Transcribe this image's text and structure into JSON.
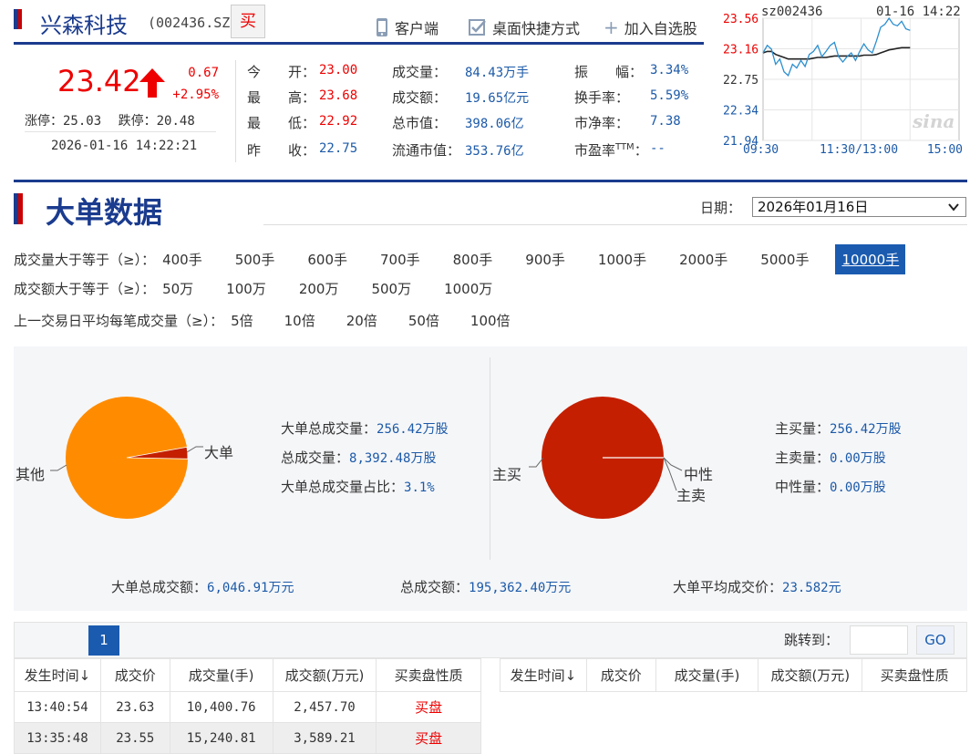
{
  "header": {
    "stock_name": "兴森科技",
    "stock_code": "(002436.SZ)",
    "buy_button": "买",
    "links": [
      "客户端",
      "桌面快捷方式",
      "加入自选股"
    ]
  },
  "quote": {
    "price": "23.42",
    "change": "0.67",
    "change_pct": "+2.95%",
    "limit_up_label": "涨停：",
    "limit_up": "25.03",
    "limit_down_label": "跌停：",
    "limit_down": "20.48",
    "datetime": "2026-01-16 14:22:21",
    "rows": [
      [
        {
          "l": "今　　开：",
          "v": "23.00",
          "c": "red"
        },
        {
          "l": "成交量：",
          "v": "84.43万手",
          "c": "blue"
        },
        {
          "l": "振　　幅：",
          "v": "3.34%",
          "c": "blue"
        }
      ],
      [
        {
          "l": "最　　高：",
          "v": "23.68",
          "c": "red"
        },
        {
          "l": "成交额：",
          "v": "19.65亿元",
          "c": "blue"
        },
        {
          "l": "换手率：",
          "v": "5.59%",
          "c": "blue"
        }
      ],
      [
        {
          "l": "最　　低：",
          "v": "22.92",
          "c": "red"
        },
        {
          "l": "总市值：",
          "v": "398.06亿",
          "c": "blue"
        },
        {
          "l": "市净率：",
          "v": "7.38",
          "c": "blue"
        }
      ],
      [
        {
          "l": "昨　　收：",
          "v": "22.75",
          "c": "blue"
        },
        {
          "l": "流通市值：",
          "v": "353.76亿",
          "c": "blue"
        },
        {
          "l": "市盈率TTM：",
          "v": "--",
          "c": "blue"
        }
      ]
    ]
  },
  "mini_chart": {
    "symbol": "sz002436",
    "datetime": "01-16 14:22",
    "y_ticks": [
      "23.56",
      "23.16",
      "22.75",
      "22.34",
      "21.94"
    ],
    "x_ticks": [
      "09:30",
      "11:30/13:00",
      "15:00"
    ],
    "watermark": "sina",
    "price_line_color": "#2b8fd0",
    "avg_line_color": "#222222"
  },
  "section": {
    "title": "大单数据",
    "date_label": "日期：",
    "date_value": "2026年01月16日"
  },
  "filters": {
    "volume_label": "成交量大于等于（≥）：",
    "volume_options": [
      "400手",
      "500手",
      "600手",
      "700手",
      "800手",
      "900手",
      "1000手",
      "2000手",
      "5000手",
      "10000手"
    ],
    "volume_active": "10000手",
    "amount_label": "成交额大于等于（≥）：",
    "amount_options": [
      "50万",
      "100万",
      "200万",
      "500万",
      "1000万"
    ],
    "multiple_label": "上一交易日平均每笔成交量（≥）：",
    "multiple_options": [
      "5倍",
      "10倍",
      "20倍",
      "50倍",
      "100倍"
    ]
  },
  "summary": {
    "pie1_labels": {
      "big": "大单",
      "other": "其他"
    },
    "big_volume_label": "大单总成交量：",
    "big_volume": "256.42万股",
    "total_volume_label": "总成交量：",
    "total_volume": "8,392.48万股",
    "big_ratio_label": "大单总成交量占比：",
    "big_ratio": "3.1%",
    "pie2_labels": {
      "buy": "主买",
      "neutral": "中性",
      "sell": "主卖"
    },
    "buy_volume_label": "主买量：",
    "buy_volume": "256.42万股",
    "sell_volume_label": "主卖量：",
    "sell_volume": "0.00万股",
    "neutral_volume_label": "中性量：",
    "neutral_volume": "0.00万股",
    "big_amount_label": "大单总成交额：",
    "big_amount": "6,046.91万元",
    "total_amount_label": "总成交额：",
    "total_amount": "195,362.40万元",
    "avg_price_label": "大单平均成交价：",
    "avg_price": "23.582元",
    "colors": {
      "orange": "#ff8c00",
      "darkred": "#c41f00"
    }
  },
  "pager": {
    "page": "1",
    "jump_label": "跳转到：",
    "go": "GO"
  },
  "table": {
    "headers": [
      "发生时间↓",
      "成交价",
      "成交量(手)",
      "成交额(万元)",
      "买卖盘性质"
    ],
    "rows": [
      [
        "13:40:54",
        "23.63",
        "10,400.76",
        "2,457.70",
        "买盘"
      ],
      [
        "13:35:48",
        "23.55",
        "15,240.81",
        "3,589.21",
        "买盘"
      ]
    ]
  },
  "chart_data": [
    {
      "type": "pie",
      "title": "",
      "labels": [
        "大单",
        "其他"
      ],
      "values": [
        3.1,
        96.9
      ],
      "colors": [
        "#c41f00",
        "#ff8c00"
      ]
    },
    {
      "type": "pie",
      "title": "",
      "labels": [
        "主买",
        "中性",
        "主卖"
      ],
      "values": [
        100,
        0,
        0
      ],
      "colors": [
        "#c41f00",
        "#ff8c00",
        "#999999"
      ]
    },
    {
      "type": "line",
      "title": "",
      "ylim": [
        21.94,
        23.56
      ],
      "series": [
        {
          "x": [
            "09:30",
            "09:36",
            "09:42",
            "09:48",
            "09:54",
            "10:00",
            "10:06",
            "10:12",
            "10:18",
            "10:24",
            "10:30",
            "10:36",
            "10:42",
            "10:48",
            "10:54",
            "11:00",
            "11:06",
            "11:12",
            "11:18",
            "11:24",
            "11:30",
            "13:00",
            "13:06",
            "13:12",
            "13:18",
            "13:24",
            "13:30",
            "13:36",
            "13:42",
            "13:48",
            "13:54",
            "14:00",
            "14:06",
            "14:12",
            "14:18",
            "14:22"
          ],
          "values": [
            23.1,
            23.2,
            23.15,
            22.95,
            23.02,
            22.85,
            22.8,
            22.95,
            22.9,
            23.0,
            22.92,
            23.08,
            23.12,
            23.2,
            23.05,
            23.12,
            23.2,
            23.24,
            23.05,
            22.98,
            23.05,
            23.1,
            23.0,
            23.12,
            23.22,
            23.14,
            23.1,
            23.26,
            23.44,
            23.48,
            23.56,
            23.48,
            23.46,
            23.52,
            23.42,
            23.4
          ]
        },
        {
          "values": [
            23.1,
            23.12,
            23.12,
            23.08,
            23.06,
            23.04,
            23.02,
            23.02,
            23.02,
            23.02,
            23.02,
            23.02,
            23.03,
            23.04,
            23.04,
            23.04,
            23.05,
            23.06,
            23.06,
            23.06,
            23.06,
            23.06,
            23.06,
            23.06,
            23.07,
            23.07,
            23.07,
            23.08,
            23.1,
            23.12,
            23.14,
            23.15,
            23.16,
            23.17,
            23.17,
            23.17
          ]
        }
      ]
    }
  ]
}
